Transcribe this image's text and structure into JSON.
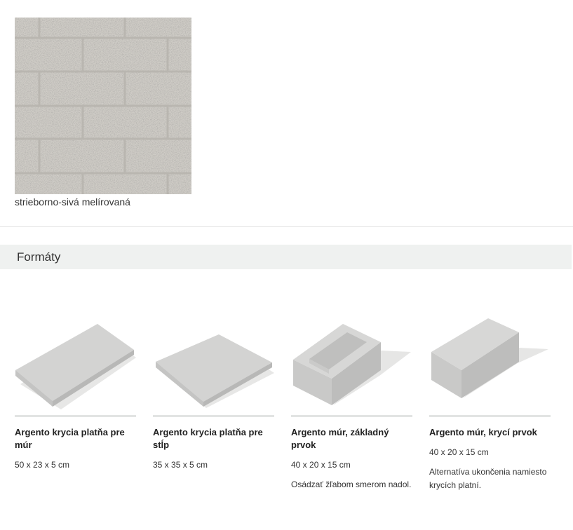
{
  "color_swatch": {
    "label": "strieborno-sivá melírovaná",
    "base_color": "#cfccc6"
  },
  "formats_section": {
    "title": "Formáty",
    "products": [
      {
        "name": "Argento krycia platňa pre múr",
        "dimensions": "50 x 23 x 5 cm",
        "note": "",
        "icon": "wall-capping-slab-image"
      },
      {
        "name": "Argento krycia platňa pre stĺp",
        "dimensions": "35 x 35 x 5 cm",
        "note": "",
        "icon": "pillar-capping-slab-image"
      },
      {
        "name": "Argento múr, základný prvok",
        "dimensions": "40 x 20 x 15 cm",
        "note": "Osádzať žľabom smerom nadol.",
        "icon": "wall-base-block-image"
      },
      {
        "name": "Argento múr, krycí prvok",
        "dimensions": "40 x 20 x 15 cm",
        "note": "Alternatíva ukončenia namiesto krycích platní.",
        "icon": "wall-cover-block-image"
      }
    ]
  }
}
